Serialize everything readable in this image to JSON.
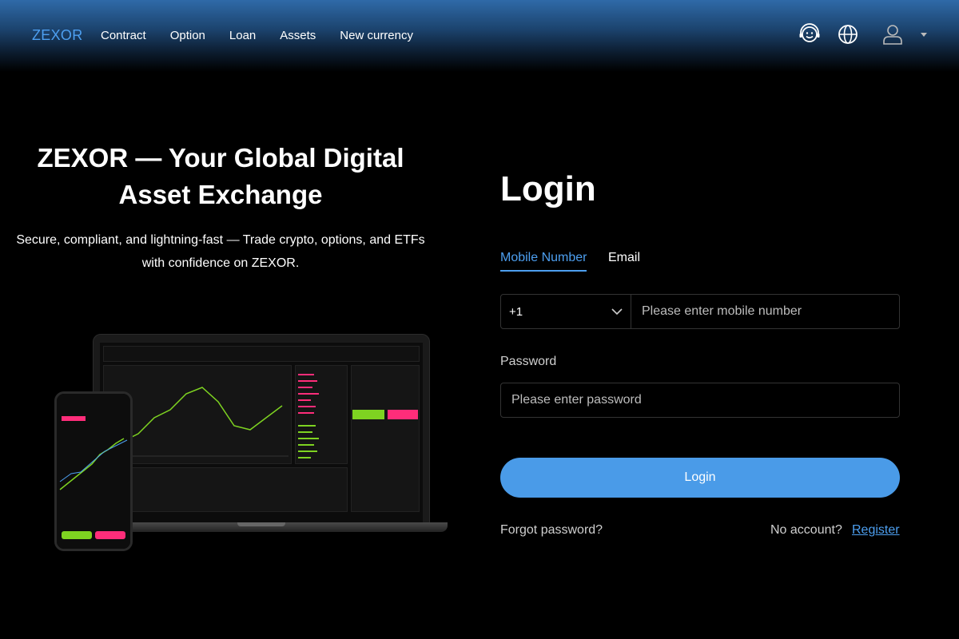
{
  "header": {
    "brand": "ZEXOR",
    "nav": [
      "Contract",
      "Option",
      "Loan",
      "Assets",
      "New currency"
    ],
    "icons": [
      "support-icon",
      "globe-icon",
      "user-icon",
      "caret-down-icon"
    ]
  },
  "hero": {
    "title": "ZEXOR — Your Global Digital Asset Exchange",
    "subtitle": "Secure, compliant, and lightning-fast — Trade crypto, options, and ETFs with confidence on ZEXOR."
  },
  "login": {
    "title": "Login",
    "tabs": [
      "Mobile Number",
      "Email"
    ],
    "country_code": "+1",
    "mobile_placeholder": "Please enter mobile number",
    "password_label": "Password",
    "password_placeholder": "Please enter password",
    "submit": "Login",
    "forgot": "Forgot password?",
    "no_account": "No account?",
    "register": "Register"
  },
  "colors": {
    "accent": "#4d9ff0",
    "button": "#4a9be8",
    "buy": "#7ed321",
    "sell": "#ff2d7a"
  }
}
